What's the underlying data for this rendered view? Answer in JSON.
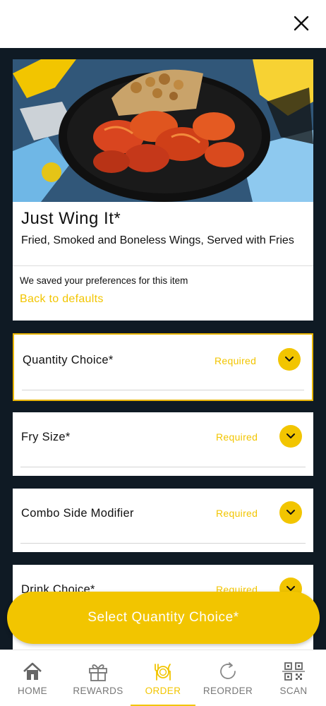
{
  "close": {
    "icon": "close-icon"
  },
  "item": {
    "title": "Just Wing It*",
    "description": "Fried, Smoked and Boneless Wings, Served with Fries",
    "preferences_note": "We saved your preferences for this item",
    "back_to_defaults": "Back to defaults"
  },
  "options": [
    {
      "label": "Quantity Choice*",
      "status": "Required"
    },
    {
      "label": "Fry Size*",
      "status": "Required"
    },
    {
      "label": "Combo Side Modifier",
      "status": "Required"
    },
    {
      "label": "Drink Choice*",
      "status": "Required"
    }
  ],
  "cta": {
    "label": "Select Quantity Choice*"
  },
  "nav": {
    "items": [
      {
        "label": "HOME",
        "icon": "home-icon"
      },
      {
        "label": "REWARDS",
        "icon": "gift-icon"
      },
      {
        "label": "ORDER",
        "icon": "utensils-icon",
        "active": true
      },
      {
        "label": "REORDER",
        "icon": "reorder-icon"
      },
      {
        "label": "SCAN",
        "icon": "qr-code-icon"
      }
    ]
  },
  "colors": {
    "accent": "#f2c500",
    "background": "#0f1a24",
    "card": "#ffffff"
  }
}
